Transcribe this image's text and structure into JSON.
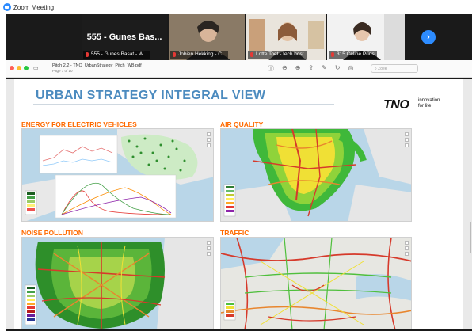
{
  "app": {
    "title": "Zoom Meeting"
  },
  "participants": [
    {
      "name": "555 - Gunes Basat - W...",
      "muted": true
    },
    {
      "name": "Jobien Hekking - C...",
      "muted": true
    },
    {
      "name": "Lotte Toet - tech host",
      "muted": true
    },
    {
      "name": "315 Celine Prins",
      "muted": true
    }
  ],
  "active_tile": {
    "display_name": "555 - Gunes Bas..."
  },
  "pdf": {
    "filename": "Pitch 2.2 - TNO_UrbanStrategy_Pitch_WB.pdf",
    "page_info": "Page 7 of 10",
    "search_placeholder": "Zoek"
  },
  "slide": {
    "title": "URBAN STRATEGY INTEGRAL VIEW",
    "logo_text": "TNO",
    "logo_tagline_1": "innovation",
    "logo_tagline_2": "for life",
    "panels": [
      {
        "title": "ENERGY FOR ELECTRIC VEHICLES"
      },
      {
        "title": "AIR QUALITY"
      },
      {
        "title": "NOISE POLLUTION"
      },
      {
        "title": "TRAFFIC"
      }
    ]
  },
  "colors": {
    "zoom_blue": "#2d8cff",
    "slide_title_blue": "#4c8bbf",
    "panel_title_orange": "#ff6a00",
    "water": "#b9d6e8",
    "land": "#ececec",
    "green": "#4fbf3c",
    "yellow": "#f2e43a",
    "red": "#d63a2b"
  }
}
